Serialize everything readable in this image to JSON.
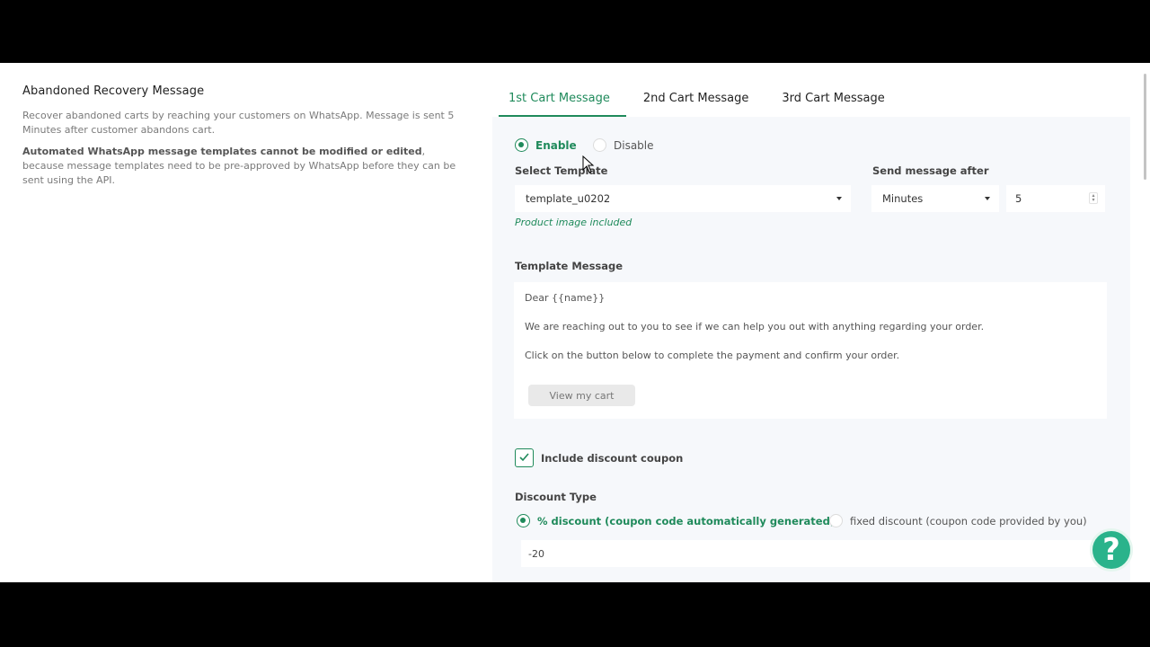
{
  "left": {
    "title": "Abandoned Recovery Message",
    "description": "Recover abandoned carts by reaching your customers on WhatsApp. Message is sent 5 Minutes after customer abandons cart.",
    "note_bold": "Automated WhatsApp message templates cannot be modified or edited",
    "note_rest": ", because message templates need to be pre-approved by WhatsApp before they can be sent using the API."
  },
  "tabs": [
    {
      "label": "1st Cart Message",
      "active": true
    },
    {
      "label": "2nd Cart Message",
      "active": false
    },
    {
      "label": "3rd Cart Message",
      "active": false
    }
  ],
  "status": {
    "enable_label": "Enable",
    "disable_label": "Disable",
    "selected": "Enable"
  },
  "template": {
    "label": "Select Template",
    "value": "template_u0202",
    "hint": "Product image included"
  },
  "send_after": {
    "label": "Send message after",
    "unit": "Minutes",
    "amount": "5"
  },
  "message": {
    "label": "Template Message",
    "lines": [
      "Dear {{name}}",
      "We are reaching out to you to see if we can help you out with anything regarding your order.",
      "Click on the button below to complete the payment and confirm your order."
    ],
    "button_label": "View my cart"
  },
  "discount": {
    "checkbox_label": "Include discount coupon",
    "checked": true,
    "type_label": "Discount Type",
    "percent_label": "% discount (coupon code automatically generated)",
    "fixed_label": "fixed discount (coupon code provided by you)",
    "selected": "percent",
    "value": "-20"
  },
  "help": {
    "icon": "question-icon",
    "glyph": "?"
  },
  "colors": {
    "accent": "#1f8a5b",
    "help": "#2ab38b"
  }
}
